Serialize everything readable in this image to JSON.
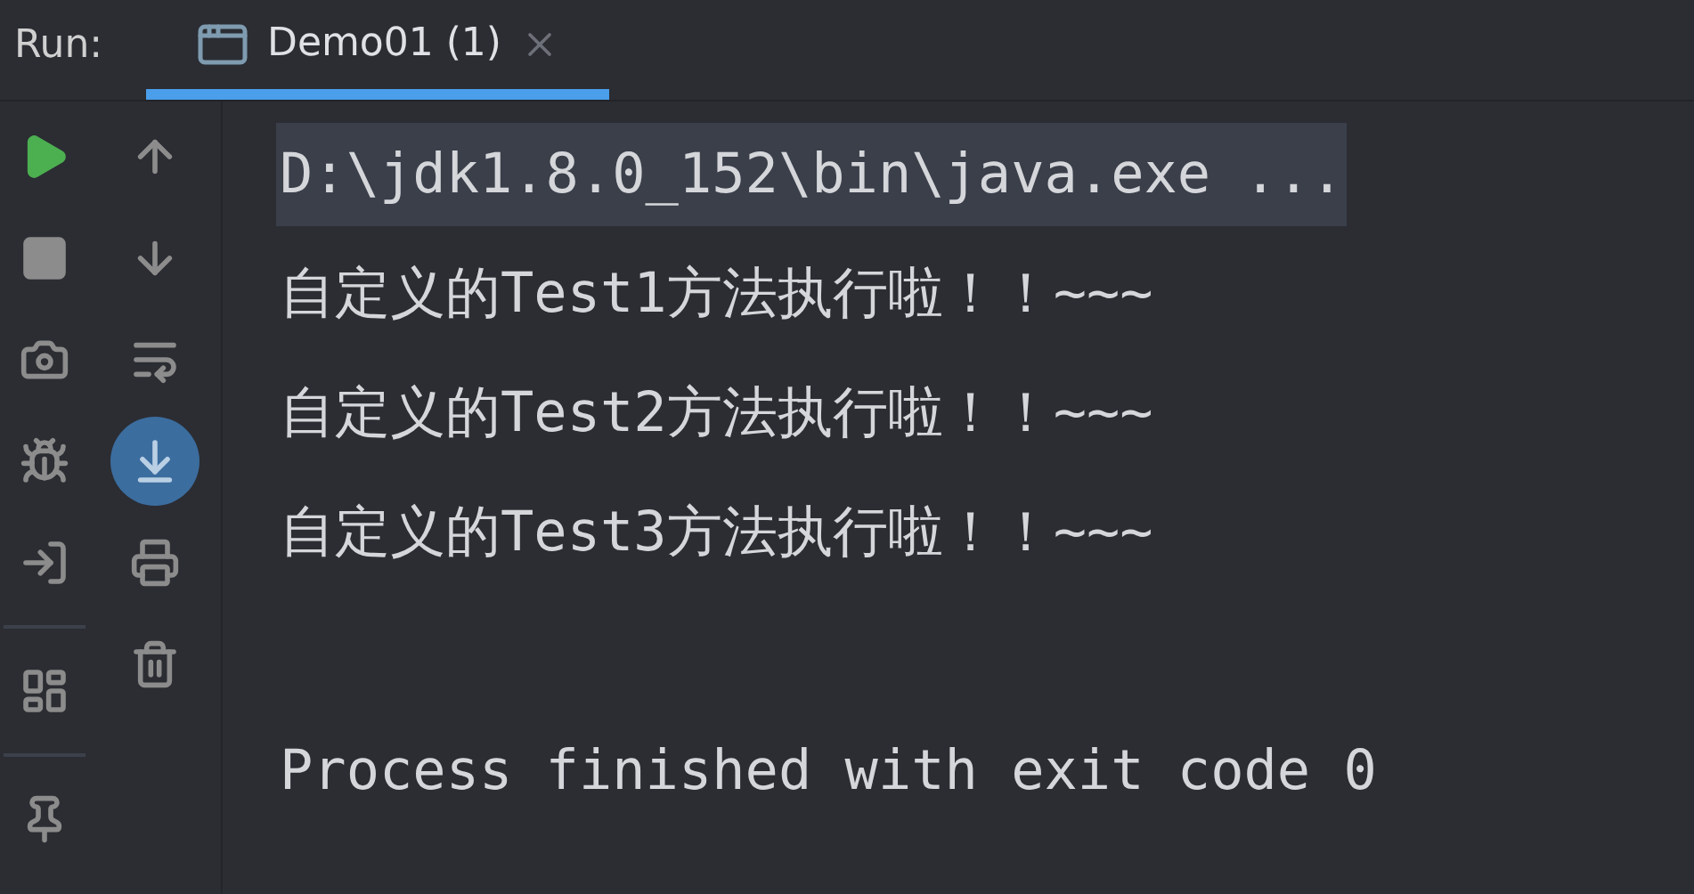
{
  "run_panel": {
    "label": "Run:",
    "tabs": [
      {
        "title": "Demo01 (1)",
        "selected": true
      }
    ]
  },
  "toolbar": {
    "left": [
      {
        "kind": "run"
      },
      {
        "kind": "stop"
      },
      {
        "kind": "camera"
      },
      {
        "kind": "debug"
      },
      {
        "kind": "import"
      },
      {
        "kind": "divider"
      },
      {
        "kind": "layout"
      },
      {
        "kind": "divider"
      },
      {
        "kind": "pin"
      }
    ],
    "right": [
      {
        "kind": "up",
        "selected": false
      },
      {
        "kind": "down",
        "selected": false
      },
      {
        "kind": "wrap",
        "selected": false
      },
      {
        "kind": "scroll-end",
        "selected": true
      },
      {
        "kind": "print",
        "selected": false
      },
      {
        "kind": "trash",
        "selected": false
      }
    ]
  },
  "console": {
    "lines": [
      {
        "text": "D:\\jdk1.8.0_152\\bin\\java.exe ...",
        "highlighted": true,
        "kind": "command"
      },
      {
        "text": "自定义的Test1方法执行啦！！~~~",
        "highlighted": false,
        "kind": "output"
      },
      {
        "text": "自定义的Test2方法执行啦！！~~~",
        "highlighted": false,
        "kind": "output"
      },
      {
        "text": "自定义的Test3方法执行啦！！~~~",
        "highlighted": false,
        "kind": "output"
      },
      {
        "text": "Process finished with exit code 0",
        "highlighted": false,
        "kind": "exit"
      }
    ]
  }
}
